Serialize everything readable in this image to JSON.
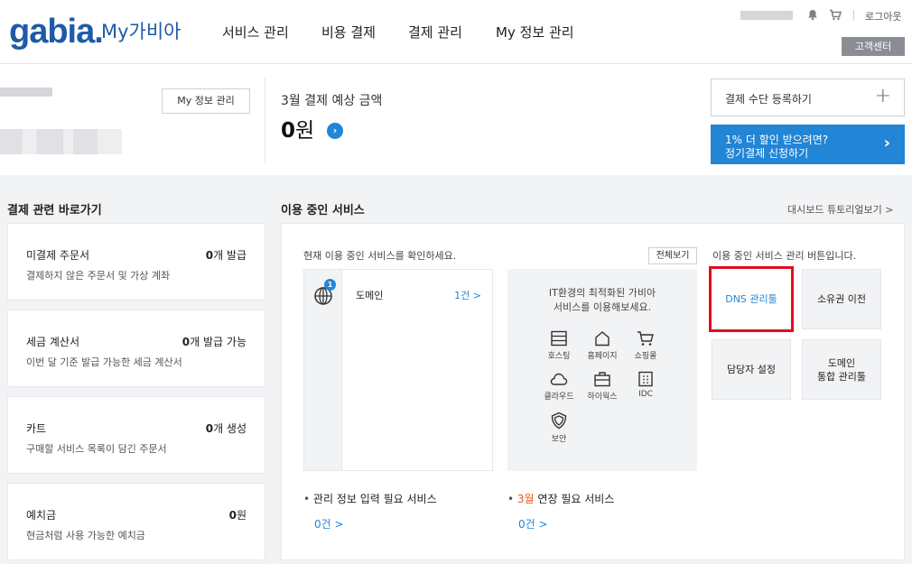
{
  "header": {
    "logo": "gabia.",
    "logo_sub": "My가비아",
    "nav": [
      "서비스 관리",
      "비용 결제",
      "결제 관리",
      "My 정보 관리"
    ],
    "logout": "로그아웃",
    "customer_center": "고객센터",
    "icons": [
      "bell-icon",
      "cart-icon"
    ]
  },
  "profile": {
    "myinfo_button": "My 정보 관리"
  },
  "payment": {
    "title": "3월 결제 예상 금액",
    "amount": "0",
    "unit": "원",
    "go_icon": "chevron-right-icon"
  },
  "actions": {
    "pay_method": "결제 수단 등록하기",
    "pay_method_icon": "+",
    "promo_line1": "1% 더 할인 받으려면?",
    "promo_line2": "정기결제 신청하기",
    "promo_arrow": "›"
  },
  "sections": {
    "left_title": "결제 관련 바로가기",
    "main_title": "이용 중인 서비스",
    "tutorial": "대시보드 튜토리얼보기 >"
  },
  "cards": [
    {
      "title": "미결제 주문서",
      "count_num": "0",
      "count_suffix": "개 발급",
      "desc": "결제하지 않은 주문서 및 가상 계좌"
    },
    {
      "title": "세금 계산서",
      "count_num": "0",
      "count_suffix": "개 발급 가능",
      "desc": "이번 달 기준 발급 가능한 세금 계산서"
    },
    {
      "title": "카트",
      "count_num": "0",
      "count_suffix": "개 생성",
      "desc": "구매할 서비스 목록이 담긴 주문서"
    },
    {
      "title": "예치금",
      "count_num": "0",
      "count_suffix": "원",
      "desc": "현금처럼 사용 가능한 예치금"
    }
  ],
  "services": {
    "info": "현재 이용 중인 서비스를 확인하세요.",
    "view_all": "전체보기",
    "domain_badge": "1",
    "domain_label": "도메인",
    "domain_count": "1건 >",
    "promo_text_1": "IT환경의 최적화된 가비아",
    "promo_text_2": "서비스를 이용해보세요.",
    "promo_items": [
      "호스팅",
      "홈페이지",
      "쇼핑몰",
      "클라우드",
      "하이웍스",
      "IDC",
      "보안"
    ],
    "mgmt_info": "이용 중인 서비스 관리 버튼입니다.",
    "mgmt_buttons": [
      "DNS 관리툴",
      "소유권 이전",
      "담당자 설정",
      "도메인",
      "통합 관리툴"
    ],
    "bottom_left_dot": "•",
    "bottom_left": "관리 정보 입력 필요 서비스",
    "bottom_left_count": "0건 >",
    "bottom_right_dot": "•",
    "bottom_right_hl": "3월",
    "bottom_right": "연장 필요 서비스",
    "bottom_right_count": "0건 >"
  },
  "colors": {
    "brand": "#1f5aa8",
    "accent": "#2285d6",
    "highlight_border": "#e30d1f",
    "orange": "#e8581d"
  }
}
